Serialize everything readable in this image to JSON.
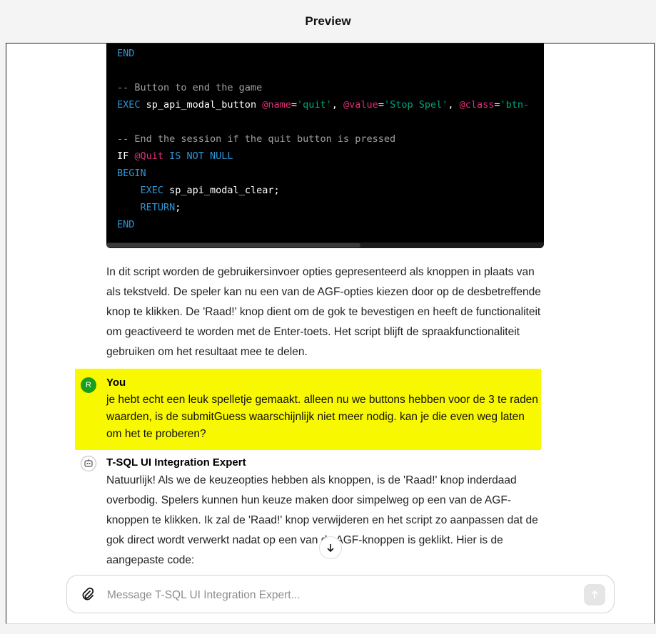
{
  "header": {
    "title": "Preview"
  },
  "code": {
    "lines": [
      [
        [
          "kw",
          "END"
        ]
      ],
      [],
      [
        [
          "cm",
          "-- Button to end the game"
        ]
      ],
      [
        [
          "kw",
          "EXEC "
        ],
        [
          "pl",
          "sp_api_modal_button "
        ],
        [
          "var",
          "@name"
        ],
        [
          "pl",
          "="
        ],
        [
          "str",
          "'quit'"
        ],
        [
          "pl",
          ", "
        ],
        [
          "var",
          "@value"
        ],
        [
          "pl",
          "="
        ],
        [
          "str",
          "'Stop Spel'"
        ],
        [
          "pl",
          ", "
        ],
        [
          "var",
          "@class"
        ],
        [
          "pl",
          "="
        ],
        [
          "str",
          "'btn-"
        ]
      ],
      [],
      [
        [
          "cm",
          "-- End the session if the quit button is pressed"
        ]
      ],
      [
        [
          "pl",
          "IF "
        ],
        [
          "var",
          "@Quit"
        ],
        [
          "kw",
          " IS NOT NULL"
        ]
      ],
      [
        [
          "kw",
          "BEGIN"
        ]
      ],
      [
        [
          "pl",
          "    "
        ],
        [
          "kw",
          "EXEC "
        ],
        [
          "pl",
          "sp_api_modal_clear;"
        ]
      ],
      [
        [
          "pl",
          "    "
        ],
        [
          "kw",
          "RETURN"
        ],
        [
          "pl",
          ";"
        ]
      ],
      [
        [
          "kw",
          "END"
        ]
      ]
    ]
  },
  "assistant_prev": {
    "text": "In dit script worden de gebruikersinvoer opties gepresenteerd als knoppen in plaats van als tekstveld. De speler kan nu een van de AGF-opties kiezen door op de desbetreffende knop te klikken. De 'Raad!' knop dient om de gok te bevestigen en heeft de functionaliteit om geactiveerd te worden met de Enter-toets. Het script blijft de spraakfunctionaliteit gebruiken om het resultaat mee te delen."
  },
  "user_message": {
    "author": "You",
    "avatar_letter": "R",
    "text": "je hebt echt een leuk spelletje gemaakt. alleen nu we buttons hebben voor de 3 te raden waarden, is de submitGuess waarschijnlijk niet meer nodig. kan je die even weg laten om het te proberen?"
  },
  "assistant_message": {
    "author": "T-SQL UI Integration Expert",
    "text": "Natuurlijk! Als we de keuzeopties hebben als knoppen, is de 'Raad!' knop inderdaad overbodig. Spelers kunnen hun keuze maken door simpelweg op een van de AGF-knoppen te klikken. Ik zal de 'Raad!' knop verwijderen en het script zo aanpassen dat de gok direct wordt verwerkt nadat op een van de AGF-knoppen is geklikt. Hier is de aangepaste code:"
  },
  "composer": {
    "placeholder": "Message T-SQL UI Integration Expert..."
  },
  "colors": {
    "highlight": "#f8f800",
    "user_avatar": "#19a01a",
    "code_keyword": "#2e95d3",
    "code_comment": "#a1a1a1",
    "code_variable": "#df3079",
    "code_string": "#00a67d"
  },
  "icons": [
    "paperclip-icon",
    "send-arrow-icon",
    "arrow-down-icon",
    "bot-avatar-icon"
  ]
}
